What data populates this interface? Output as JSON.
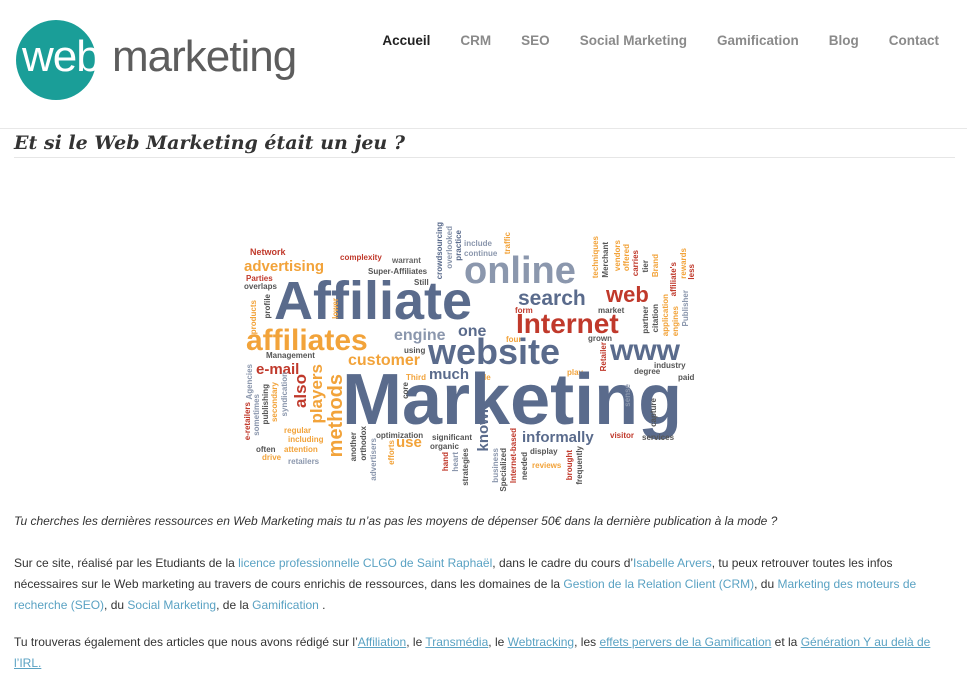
{
  "logo": {
    "web": "web",
    "marketing": "marketing"
  },
  "nav": [
    "Accueil",
    "CRM",
    "SEO",
    "Social Marketing",
    "Gamification",
    "Blog",
    "Contact"
  ],
  "title": "Et si le Web Marketing était un jeu ?",
  "intro": "Tu cherches les dernières ressources en Web Marketing mais tu n’as pas les moyens de dépenser 50€ dans la dernière publication à la mode ?",
  "p1": {
    "t1": "Sur ce site, réalisé par les Etudiants de la ",
    "l1": "licence professionnelle CLGO de Saint Raphaël",
    "t2": ", dans le cadre du cours d’",
    "l2": "Isabelle Arvers",
    "t3": ",  tu peux retrouver toutes les infos nécessaires sur le Web marketing au travers de cours enrichis de ressources, dans les domaines de la ",
    "l3": "Gestion de la Relation Client (CRM)",
    "t4": ", du ",
    "l4": "Marketing des moteurs de recherche (SEO)",
    "t5": ", du ",
    "l5": "Social Marketing",
    "t6": ", de la ",
    "l6": "Gamification",
    "t7": " ."
  },
  "p2": {
    "t1": "Tu trouveras également des articles que nous avons rédigé sur l’",
    "l1": "Affiliation",
    "t2": ", le ",
    "l2": "Transmédia",
    "t3": ", le ",
    "l3": "Webtracking",
    "t4": ", les ",
    "l4": "effets pervers de la Gamification",
    "t5": " et la ",
    "l5": "Génération Y au delà de l’IRL."
  },
  "cloud": {
    "Affiliate": "Affiliate",
    "Marketing": "Marketing",
    "website": "website",
    "online": "online",
    "Internet": "Internet",
    "affiliates": "affiliates",
    "search": "search",
    "web": "web",
    "www": "www",
    "advertising": "advertising",
    "engine": "engine",
    "one": "one",
    "customer": "customer",
    "e-mail": "e-mail",
    "informally": "informally",
    "much": "much",
    "use": "use",
    "methods": "methods",
    "players": "players",
    "also": "also",
    "known": "known",
    "Network": "Network",
    "complexity": "complexity",
    "warrant": "warrant",
    "Super-Affiliates": "Super-Affiliates",
    "Still": "Still",
    "Parties": "Parties",
    "overlaps": "overlaps",
    "Management": "Management",
    "crowdsourcing": "crowdsourcing",
    "overlooked": "overlooked",
    "practice": "practice",
    "include": "include",
    "continue": "continue",
    "traffic": "traffic",
    "form": "form",
    "four": "four",
    "market": "market",
    "grown": "grown",
    "using": "using",
    "industry": "industry",
    "degree": "degree",
    "paid": "paid",
    "Third": "Third",
    "role": "role",
    "play": "play",
    "services": "services",
    "visitor": "visitor",
    "display": "display",
    "reviews": "reviews",
    "significant": "significant",
    "optimization": "optimization",
    "organic": "organic",
    "regular": "regular",
    "including": "including",
    "often": "often",
    "attention": "attention",
    "drive": "drive",
    "retailers": "retailers",
    "e-retailers": "e-retailers",
    "sometimes": "sometimes",
    "publishing": "publishing",
    "secondary": "secondary",
    "syndication": "syndication",
    "Agencies": "Agencies",
    "profile": "profile",
    "products": "products",
    "lower": "lower",
    "another": "another",
    "orthodox": "orthodox",
    "advertisers": "advertisers",
    "efforts": "efforts",
    "core": "core",
    "hand": "hand",
    "heart": "heart",
    "strategies": "strategies",
    "business": "business",
    "Specialized": "Specialized",
    "Internet-based": "Internet-based",
    "needed": "needed",
    "brought": "brought",
    "frequently": "frequently",
    "techniques": "techniques",
    "Merchant": "Merchant",
    "vendors": "vendors",
    "offered": "offered",
    "carries": "carries",
    "tier": "tier",
    "Brand": "Brand",
    "affiliate's": "affiliate's",
    "rewards": "rewards",
    "less": "less",
    "partner": "partner",
    "citation": "citation",
    "application": "application",
    "engines": "engines",
    "Publisher": "Publisher",
    "Retailer": "Retailer",
    "capture": "capture",
    "sense": "sense"
  }
}
